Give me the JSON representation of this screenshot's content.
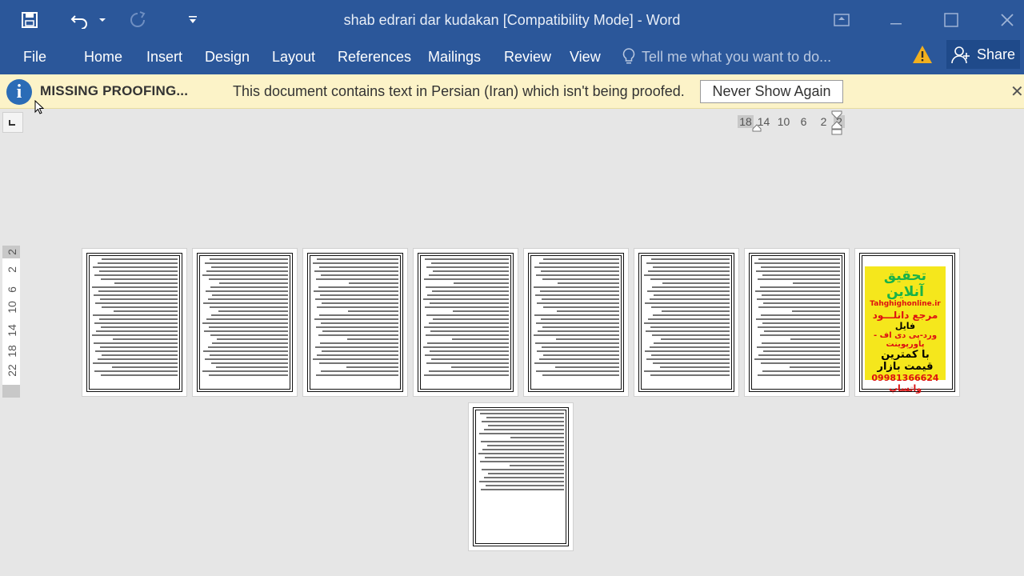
{
  "window": {
    "title": "shab edrari dar kudakan [Compatibility Mode] - Word"
  },
  "ribbon": {
    "tabs": [
      "File",
      "Home",
      "Insert",
      "Design",
      "Layout",
      "References",
      "Mailings",
      "Review",
      "View"
    ],
    "tell_me_placeholder": "Tell me what you want to do...",
    "share_label": "Share"
  },
  "message_bar": {
    "heading": "MISSING PROOFING...",
    "text": "This document contains text in Persian (Iran) which isn't being proofed.",
    "button_label": "Never Show Again",
    "close_glyph": "✕"
  },
  "horizontal_ruler": [
    "18",
    "14",
    "10",
    "6",
    "2",
    "2"
  ],
  "vertical_ruler": [
    "2",
    "2",
    "6",
    "10",
    "14",
    "18",
    "22"
  ],
  "pages": {
    "count": 9,
    "ad_page": {
      "title": "تحقیق آنلاین",
      "site": "Tahghighonline.ir",
      "reference": "مرجع دانلـــود",
      "file_label": "فایل",
      "file_types": "ورد-پی دی اف - پاورپوینت",
      "price": "با کمترین قیمت بازار",
      "phone": "09981366624 واتساپ"
    }
  },
  "colors": {
    "ribbon_blue": "#2b579a",
    "message_bar": "#fcf3c8",
    "canvas": "#e6e6e6",
    "ad_background": "#f5e71c"
  }
}
